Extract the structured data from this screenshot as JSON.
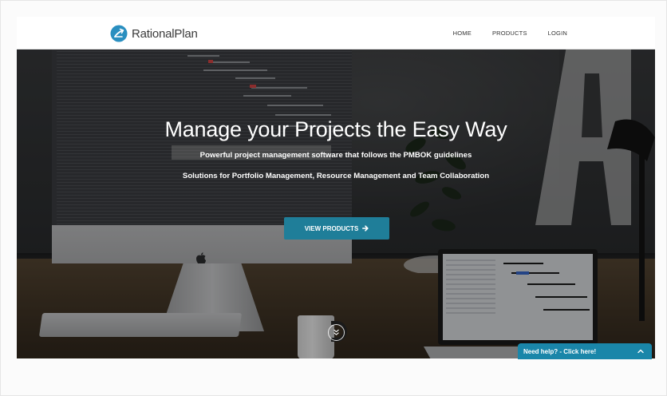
{
  "brand": {
    "name": "RationalPlan",
    "logo_icon": "rationalplan-logo-icon",
    "accent_color": "#2a8fc0"
  },
  "nav": {
    "items": [
      {
        "label": "HOME"
      },
      {
        "label": "PRODUCTS"
      },
      {
        "label": "LOGIN"
      }
    ]
  },
  "hero": {
    "title": "Manage your Projects the Easy Way",
    "subtitle_prefix": "Powerful project management software that follows the ",
    "subtitle_highlight": "PMBOK",
    "subtitle_suffix": " guidelines",
    "subtitle_2": "Solutions for Portfolio Management, Resource Management and Team Collaboration",
    "cta_label": "VIEW PRODUCTS",
    "cta_icon": "arrow-right-icon",
    "cta_color": "#1f7e99",
    "scroll_icon": "double-chevron-down-icon"
  },
  "help_widget": {
    "label": "Need help? - Click here!",
    "icon": "chevron-up-icon",
    "color": "#1a86a9"
  }
}
